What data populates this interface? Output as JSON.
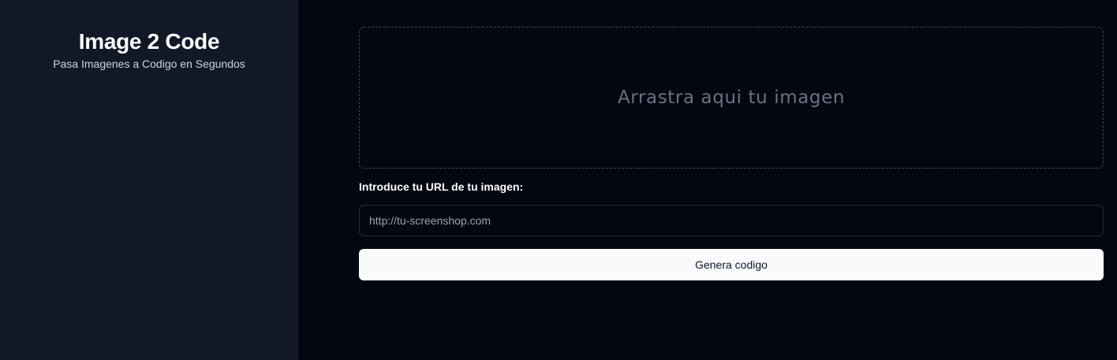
{
  "sidebar": {
    "title": "Image 2 Code",
    "subtitle": "Pasa Imagenes a Codigo en Segundos"
  },
  "main": {
    "dropzone": {
      "text": "Arrastra aqui tu imagen"
    },
    "url_form": {
      "label": "Introduce tu URL de tu imagen:",
      "placeholder": "http://tu-screenshop.com",
      "value": "",
      "submit_label": "Genera codigo"
    }
  },
  "colors": {
    "sidebar_bg": "#111827",
    "main_bg": "#030711",
    "button_bg": "#f8fafc",
    "button_text": "#0f172a"
  }
}
